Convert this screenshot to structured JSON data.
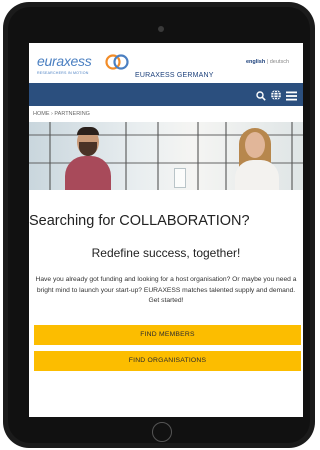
{
  "header": {
    "logo_text": "euraxess",
    "logo_tagline": "RESEARCHERS IN MOTION",
    "country": "EURAXESS GERMANY",
    "language": {
      "active": "english",
      "separator": " | ",
      "other": "deutsch"
    }
  },
  "nav": {
    "icons": [
      "search-icon",
      "globe-icon",
      "menu-icon"
    ],
    "bar_color": "#2b4f7e"
  },
  "breadcrumb": "HOME › PARTNERING",
  "main": {
    "headline": "Searching for COLLABORATION?",
    "subheadline": "Redefine success, together!",
    "body": "Have you already got funding and looking for a host organisation? Or maybe you need a bright mind to launch your start-up? EURAXESS matches talented supply and demand. Get started!",
    "buttons": {
      "find_members": "FIND MEMBERS",
      "find_organisations": "FIND ORGANISATIONS"
    }
  },
  "colors": {
    "accent": "#fcbd00",
    "brand_blue": "#4a7fc1",
    "nav_blue": "#2b4f7e"
  }
}
